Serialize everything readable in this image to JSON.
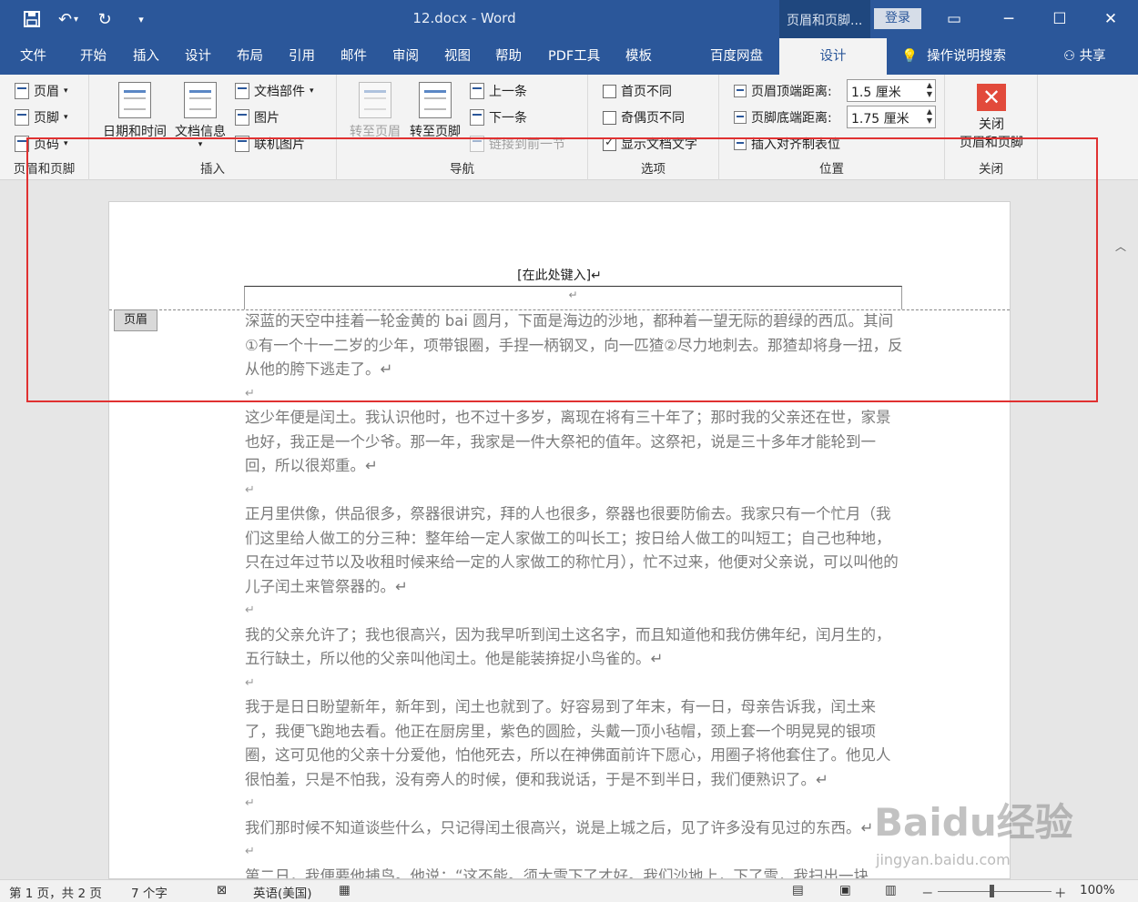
{
  "titlebar": {
    "doc_title": "12.docx  -  Word",
    "context_tab": "页眉和页脚...",
    "login": "登录",
    "qat": {
      "save_icon": "save-icon",
      "undo_icon": "undo-icon",
      "redo_icon": "redo-icon",
      "customize_icon": "customize-icon"
    }
  },
  "tabs": [
    "文件",
    "开始",
    "插入",
    "设计",
    "布局",
    "引用",
    "邮件",
    "审阅",
    "视图",
    "帮助",
    "PDF工具",
    "模板",
    "百度网盘",
    "设计"
  ],
  "tell_me": "操作说明搜索",
  "share": "共享",
  "ribbon": {
    "hf_group": {
      "header": "页眉",
      "footer": "页脚",
      "page_number": "页码",
      "label": "页眉和页脚"
    },
    "insert_group": {
      "datetime": "日期和时间",
      "docinfo": "文档信息",
      "quickparts": "文档部件",
      "picture": "图片",
      "online_picture": "联机图片",
      "label": "插入"
    },
    "nav_group": {
      "goto_header": "转至页眉",
      "goto_footer": "转至页脚",
      "previous": "上一条",
      "next": "下一条",
      "link_previous": "链接到前一节",
      "label": "导航"
    },
    "options_group": {
      "diff_first": "首页不同",
      "diff_odd_even": "奇偶页不同",
      "show_doc_text": "显示文档文字",
      "label": "选项"
    },
    "position_group": {
      "header_from_top": "页眉顶端距离:",
      "header_value": "1.5 厘米",
      "footer_from_bottom": "页脚底端距离:",
      "footer_value": "1.75 厘米",
      "insert_align_tab": "插入对齐制表位",
      "label": "位置"
    },
    "close_group": {
      "close_line1": "关闭",
      "close_line2": "页眉和页脚",
      "label": "关闭"
    }
  },
  "document": {
    "header_placeholder": "[在此处键入]↵",
    "header_mark": "↵",
    "header_tag": "页眉",
    "paragraphs": [
      "深蓝的天空中挂着一轮金黄的 bai 圆月，下面是海边的沙地，都种着一望无际的碧绿的西瓜。其间①有一个十一二岁的少年，项带银圈，手捏一柄钢叉，向一匹猹②尽力地刺去。那猹却将身一扭，反从他的胯下逃走了。↵",
      "↵",
      "这少年便是闰土。我认识他时，也不过十多岁，离现在将有三十年了；那时我的父亲还在世，家景也好，我正是一个少爷。那一年，我家是一件大祭祀的值年。这祭祀，说是三十多年才能轮到一回，所以很郑重。↵",
      "↵",
      "正月里供像，供品很多，祭器很讲究，拜的人也很多，祭器也很要防偷去。我家只有一个忙月（我们这里给人做工的分三种：整年给一定人家做工的叫长工；按日给人做工的叫短工；自己也种地，只在过年过节以及收租时候来给一定的人家做工的称忙月），忙不过来，他便对父亲说，可以叫他的儿子闰土来管祭器的。↵",
      "↵",
      "我的父亲允许了；我也很高兴，因为我早听到闰土这名字，而且知道他和我仿佛年纪，闰月生的，五行缺土，所以他的父亲叫他闰土。他是能装𢬵捉小鸟雀的。↵",
      "↵",
      "我于是日日盼望新年，新年到，闰土也就到了。好容易到了年末，有一日，母亲告诉我，闰土来了，我便飞跑地去看。他正在厨房里，紫色的圆脸，头戴一顶小毡帽，颈上套一个明晃晃的银项圈，这可见他的父亲十分爱他，怕他死去，所以在神佛面前许下愿心，用圈子将他套住了。他见人很怕羞，只是不怕我，没有旁人的时候，便和我说话，于是不到半日，我们便熟识了。↵",
      "↵",
      "我们那时候不知道谈些什么，只记得闰土很高兴，说是上城之后，见了许多没有见过的东西。↵",
      "↵",
      "第二日，我便要他捕鸟。他说：“这不能。须大雪下了才好。我们沙地上，下了雪，我扫出一块"
    ]
  },
  "watermark": {
    "text": "Baidu经验",
    "sub": "jingyan.baidu.com"
  },
  "status": {
    "page": "第 1 页，共 2 页",
    "words": "7 个字",
    "language": "英语(美国)",
    "zoom": "100%",
    "zoom_minus": "－",
    "zoom_plus": "＋"
  },
  "colors": {
    "accent": "#2b579a",
    "highlight_box": "#e03131",
    "close_button": "#e24a3b"
  }
}
